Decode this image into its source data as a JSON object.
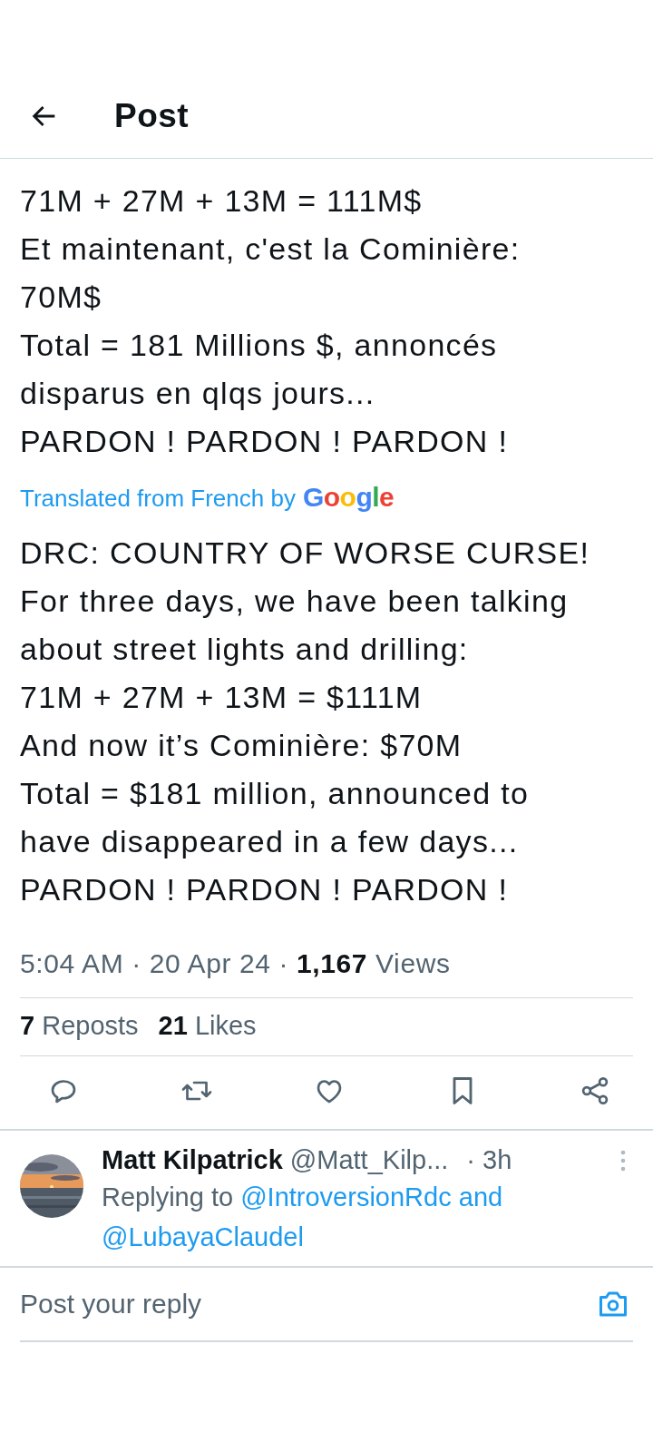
{
  "header": {
    "title": "Post"
  },
  "post": {
    "original_text": "71M + 27M + 13M = 111M$\nEt maintenant, c'est la Cominière:\n70M$\nTotal = 181 Millions $, annoncés\ndisparus en qlqs jours...\nPARDON ! PARDON ! PARDON !",
    "translation_note": "Translated from French by",
    "translation_brand": "Google",
    "translated_text": "DRC: COUNTRY OF WORSE CURSE!\nFor three days, we have been talking\nabout street lights and drilling:\n71M + 27M + 13M = $111M\nAnd now it’s Cominière: $70M\nTotal = $181 million, announced to\nhave disappeared in a few days...\nPARDON ! PARDON ! PARDON !",
    "meta": "5:04 AM · 20 Apr 24 · **1,167** Views",
    "stats": [
      "**7** Reposts",
      "**21** Likes"
    ],
    "actions": [
      {
        "kind": "reply"
      },
      {
        "kind": "repost"
      },
      {
        "kind": "like"
      },
      {
        "kind": "bookmark"
      },
      {
        "kind": "share"
      }
    ]
  },
  "reply": {
    "name": "Matt Kilpatrick",
    "handle": "@Matt_Kilp...",
    "time": "· 3h",
    "replying_prefix": "Replying to",
    "mentions": [
      "@IntroversionRdc",
      "@LubayaClaudel"
    ],
    "joiner": "and"
  },
  "composer": {
    "placeholder": "Post your reply"
  }
}
